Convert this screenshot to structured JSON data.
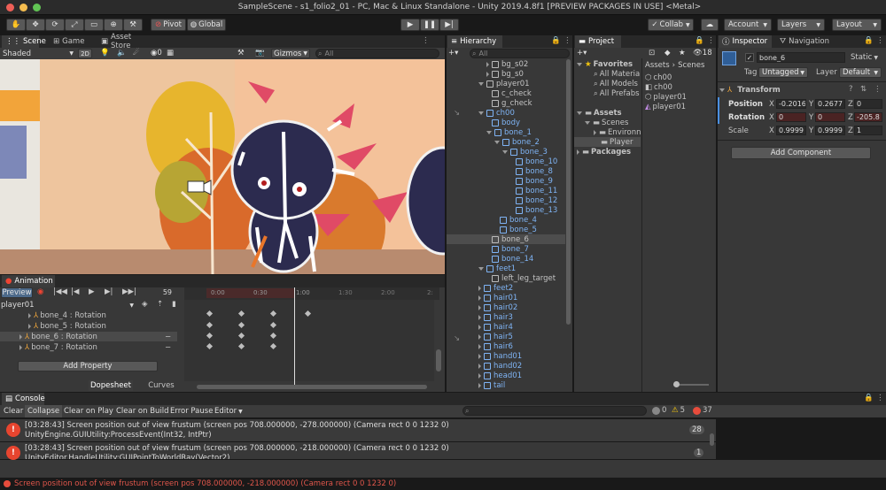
{
  "window": {
    "title": "SampleScene - s1_folio2_01 - PC, Mac & Linux Standalone - Unity 2019.4.8f1 [PREVIEW PACKAGES IN USE] <Metal>"
  },
  "toolbar": {
    "pivot": "Pivot",
    "global": "Global",
    "collab": "Collab",
    "account": "Account",
    "layers": "Layers",
    "layout": "Layout"
  },
  "scene": {
    "tabs": [
      "Scene",
      "Game",
      "Asset Store"
    ],
    "shading": "Shaded",
    "dim": "2D",
    "gizmos": "Gizmos",
    "search_placeholder": "All",
    "light_count": "0"
  },
  "hierarchy": {
    "title": "Hierarchy",
    "search_placeholder": "All",
    "items": [
      {
        "label": "bg_s02",
        "depth": 1,
        "blue": false,
        "tri": "closed"
      },
      {
        "label": "bg_s0",
        "depth": 1,
        "blue": false,
        "tri": "closed"
      },
      {
        "label": "player01",
        "depth": 0,
        "blue": false,
        "tri": "open"
      },
      {
        "label": "c_check",
        "depth": 1,
        "blue": false,
        "tri": "none"
      },
      {
        "label": "g_check",
        "depth": 1,
        "blue": false,
        "tri": "none"
      },
      {
        "label": "ch00",
        "depth": 0,
        "blue": true,
        "tri": "open"
      },
      {
        "label": "body",
        "depth": 1,
        "blue": true,
        "tri": "none"
      },
      {
        "label": "bone_1",
        "depth": 1,
        "blue": true,
        "tri": "open"
      },
      {
        "label": "bone_2",
        "depth": 2,
        "blue": true,
        "tri": "open"
      },
      {
        "label": "bone_3",
        "depth": 3,
        "blue": true,
        "tri": "open"
      },
      {
        "label": "bone_10",
        "depth": 4,
        "blue": true,
        "tri": "none"
      },
      {
        "label": "bone_8",
        "depth": 4,
        "blue": true,
        "tri": "none"
      },
      {
        "label": "bone_9",
        "depth": 4,
        "blue": true,
        "tri": "none"
      },
      {
        "label": "bone_11",
        "depth": 4,
        "blue": true,
        "tri": "none"
      },
      {
        "label": "bone_12",
        "depth": 4,
        "blue": true,
        "tri": "none"
      },
      {
        "label": "bone_13",
        "depth": 4,
        "blue": true,
        "tri": "none"
      },
      {
        "label": "bone_4",
        "depth": 2,
        "blue": true,
        "tri": "none"
      },
      {
        "label": "bone_5",
        "depth": 2,
        "blue": true,
        "tri": "none"
      },
      {
        "label": "bone_6",
        "depth": 1,
        "blue": false,
        "tri": "none",
        "selected": true
      },
      {
        "label": "bone_7",
        "depth": 1,
        "blue": true,
        "tri": "none"
      },
      {
        "label": "bone_14",
        "depth": 1,
        "blue": true,
        "tri": "none"
      },
      {
        "label": "feet1",
        "depth": 0,
        "blue": true,
        "tri": "open"
      },
      {
        "label": "left_leg_target",
        "depth": 1,
        "blue": false,
        "tri": "none"
      },
      {
        "label": "feet2",
        "depth": 0,
        "blue": true,
        "tri": "closed"
      },
      {
        "label": "hair01",
        "depth": 0,
        "blue": true,
        "tri": "closed"
      },
      {
        "label": "hair02",
        "depth": 0,
        "blue": true,
        "tri": "closed"
      },
      {
        "label": "hair3",
        "depth": 0,
        "blue": true,
        "tri": "closed"
      },
      {
        "label": "hair4",
        "depth": 0,
        "blue": true,
        "tri": "closed"
      },
      {
        "label": "hair5",
        "depth": 0,
        "blue": true,
        "tri": "closed"
      },
      {
        "label": "hair6",
        "depth": 0,
        "blue": true,
        "tri": "closed"
      },
      {
        "label": "hand01",
        "depth": 0,
        "blue": true,
        "tri": "closed"
      },
      {
        "label": "hand02",
        "depth": 0,
        "blue": true,
        "tri": "closed"
      },
      {
        "label": "head01",
        "depth": 0,
        "blue": true,
        "tri": "closed"
      },
      {
        "label": "tail",
        "depth": 0,
        "blue": true,
        "tri": "closed"
      }
    ]
  },
  "project": {
    "title": "Project",
    "hidden_count": "18",
    "favorites": "Favorites",
    "fav_items": [
      "All Materia",
      "All Models",
      "All Prefabs"
    ],
    "assets": "Assets",
    "asset_children": [
      "Scenes"
    ],
    "scene_children": [
      "Environn",
      "Player"
    ],
    "packages": "Packages",
    "breadcrumb": [
      "Assets",
      "Scenes"
    ],
    "files": [
      "ch00",
      "ch00",
      "player01",
      "player01"
    ]
  },
  "inspector": {
    "tabs": [
      "Inspector",
      "Navigation"
    ],
    "name": "bone_6",
    "static": "Static",
    "tag_label": "Tag",
    "tag": "Untagged",
    "layer_label": "Layer",
    "layer": "Default",
    "component": "Transform",
    "position_label": "Position",
    "rotation_label": "Rotation",
    "scale_label": "Scale",
    "position": {
      "x": "-0.2016",
      "y": "0.2677",
      "z": "0"
    },
    "rotation": {
      "x": "0",
      "y": "0",
      "z": "-205.8"
    },
    "scale": {
      "x": "0.9999",
      "y": "0.9999",
      "z": "1"
    },
    "add_component": "Add Component"
  },
  "animation": {
    "title": "Animation",
    "preview": "Preview",
    "frame": "59",
    "clip": "player01",
    "properties": [
      "bone_4 : Rotation",
      "bone_5 : Rotation",
      "bone_6 : Rotation",
      "bone_7 : Rotation"
    ],
    "add_property": "Add Property",
    "dopesheet": "Dopesheet",
    "curves": "Curves",
    "ticks": [
      "0:00",
      "0:30",
      "1:00",
      "1:30",
      "2:00",
      "2:"
    ]
  },
  "console": {
    "title": "Console",
    "buttons": [
      "Clear",
      "Collapse",
      "Clear on Play",
      "Clear on Build",
      "Error Pause",
      "Editor"
    ],
    "counts": {
      "info": "0",
      "warn": "5",
      "error": "37"
    },
    "entries": [
      {
        "line1": "[03:28:43] Screen position out of view frustum (screen pos 708.000000, -278.000000) (Camera rect 0 0 1232 0)",
        "line2": "UnityEngine.GUIUtility:ProcessEvent(Int32, IntPtr)",
        "count": "28"
      },
      {
        "line1": "[03:28:43] Screen position out of view frustum (screen pos 708.000000, -218.000000) (Camera rect 0 0 1232 0)",
        "line2": "UnityEditor.HandleUtility:GUIPointToWorldRay(Vector2)",
        "count": "1"
      }
    ]
  },
  "status": {
    "message": "Screen position out of view frustum (screen pos 708.000000, -218.000000) (Camera rect 0 0 1232 0)"
  }
}
